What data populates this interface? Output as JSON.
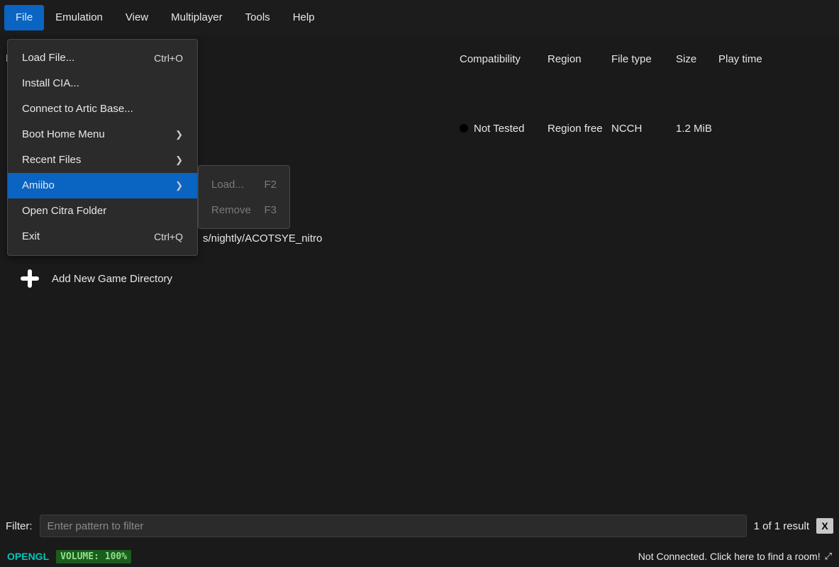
{
  "menubar": [
    "File",
    "Emulation",
    "View",
    "Multiplayer",
    "Tools",
    "Help"
  ],
  "file_menu": {
    "load_file": {
      "label": "Load File...",
      "shortcut": "Ctrl+O"
    },
    "install_cia": {
      "label": "Install CIA..."
    },
    "artic": {
      "label": "Connect to Artic Base..."
    },
    "boot_home": {
      "label": "Boot Home Menu"
    },
    "recent": {
      "label": "Recent Files"
    },
    "amiibo": {
      "label": "Amiibo"
    },
    "open_folder": {
      "label": "Open Citra Folder"
    },
    "exit": {
      "label": "Exit",
      "shortcut": "Ctrl+Q"
    }
  },
  "amiibo_sub": {
    "load": {
      "label": "Load...",
      "shortcut": "F2"
    },
    "remove": {
      "label": "Remove",
      "shortcut": "F3"
    }
  },
  "columns": {
    "name": "Name",
    "compat": "Compatibility",
    "region": "Region",
    "filetype": "File type",
    "size": "Size",
    "playtime": "Play time"
  },
  "row": {
    "compat": "Not Tested",
    "region": "Region free",
    "filetype": "NCCH",
    "size": "1.2 MiB"
  },
  "fragments": {
    "path": "s/nightly/ACOTSYE_nitro",
    "letter": "N"
  },
  "add_dir": "Add New Game Directory",
  "filter": {
    "label": "Filter:",
    "placeholder": "Enter pattern to filter",
    "result": "1 of 1 result",
    "x": "X"
  },
  "status": {
    "gl": "OPENGL",
    "vol": "VOLUME: 100%",
    "room": "Not Connected. Click here to find a room!"
  }
}
